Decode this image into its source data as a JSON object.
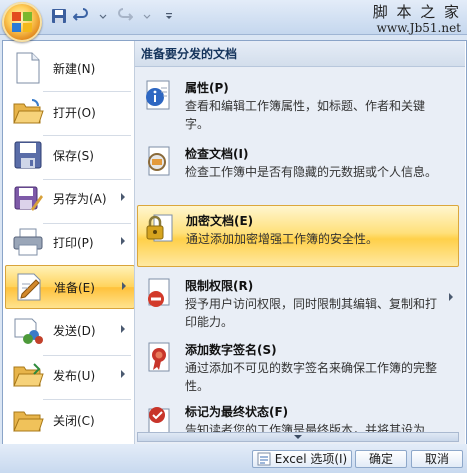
{
  "watermark": {
    "chinese": "脚 本 之 家",
    "url": "www.Jb51.net"
  },
  "quick_access": {
    "icons": [
      "save-icon",
      "undo-icon",
      "redo-icon",
      "customize-icon"
    ]
  },
  "left_menu": {
    "items": [
      {
        "label": "新建(N)",
        "icon": "new-document-icon",
        "submenu": false,
        "selected": false
      },
      {
        "label": "打开(O)",
        "icon": "open-folder-icon",
        "submenu": false,
        "selected": false
      },
      {
        "label": "保存(S)",
        "icon": "save-icon",
        "submenu": false,
        "selected": false
      },
      {
        "label": "另存为(A)",
        "icon": "save-as-icon",
        "submenu": true,
        "selected": false
      },
      {
        "label": "打印(P)",
        "icon": "printer-icon",
        "submenu": true,
        "selected": false
      },
      {
        "label": "准备(E)",
        "icon": "prepare-icon",
        "submenu": true,
        "selected": true
      },
      {
        "label": "发送(D)",
        "icon": "send-icon",
        "submenu": true,
        "selected": false
      },
      {
        "label": "发布(U)",
        "icon": "publish-icon",
        "submenu": true,
        "selected": false
      },
      {
        "label": "关闭(C)",
        "icon": "close-folder-icon",
        "submenu": false,
        "selected": false
      }
    ]
  },
  "right_panel": {
    "header": "准备要分发的文档",
    "items": [
      {
        "title": "属性(P)",
        "desc": "查看和编辑工作簿属性，如标题、作者和关键字。",
        "icon": "properties-icon",
        "selected": false,
        "submenu": false
      },
      {
        "title": "检查文档(I)",
        "desc": "检查工作簿中是否有隐藏的元数据或个人信息。",
        "icon": "inspect-icon",
        "selected": false,
        "submenu": false
      },
      {
        "title": "加密文档(E)",
        "desc": "通过添加加密增强工作簿的安全性。",
        "icon": "encrypt-icon",
        "selected": true,
        "submenu": false
      },
      {
        "title": "限制权限(R)",
        "desc": "授予用户访问权限，同时限制其编辑、复制和打印能力。",
        "icon": "restrict-icon",
        "selected": false,
        "submenu": true
      },
      {
        "title": "添加数字签名(S)",
        "desc": "通过添加不可见的数字签名来确保工作簿的完整性。",
        "icon": "signature-icon",
        "selected": false,
        "submenu": false
      },
      {
        "title": "标记为最终状态(F)",
        "desc": "告知读者您的工作簿是最终版本，并将其设为",
        "icon": "mark-final-icon",
        "selected": false,
        "submenu": false
      }
    ]
  },
  "bottom_bar": {
    "options_label": "Excel 选项(I)",
    "ok_label": "确定",
    "cancel_label": "取消"
  },
  "colors": {
    "highlight": "#ffd35c",
    "panel": "#e9eef6",
    "frame": "#dbe6f4"
  }
}
